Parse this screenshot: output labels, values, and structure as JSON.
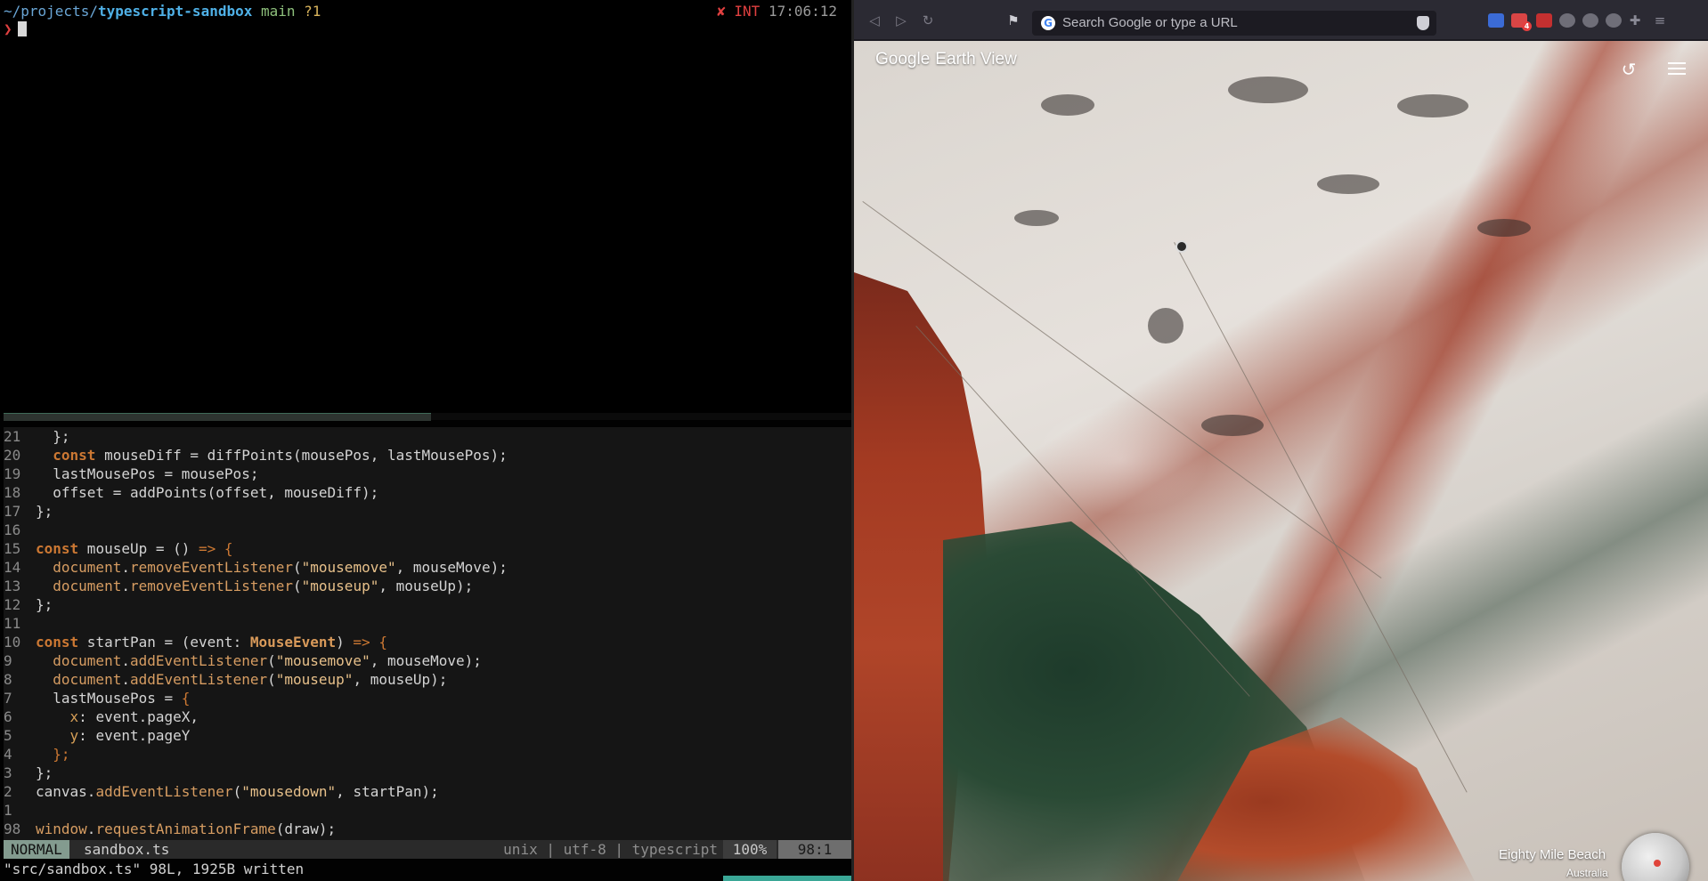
{
  "terminal": {
    "prompt": {
      "path_prefix": "~/projects/",
      "path_dir": "typescript-sandbox",
      "branch": "main",
      "git_status": "?1",
      "error_mark": "✘",
      "signal": "INT",
      "time": "17:06:12",
      "prompt_char": "❯"
    }
  },
  "vim": {
    "lines": [
      {
        "n": "21",
        "segments": [
          {
            "t": "  };",
            "c": "pun"
          }
        ]
      },
      {
        "n": "20",
        "segments": [
          {
            "t": "  ",
            "c": "pun"
          },
          {
            "t": "const",
            "c": "kw"
          },
          {
            "t": " mouseDiff = diffPoints(mousePos, lastMousePos);",
            "c": "pun"
          }
        ]
      },
      {
        "n": "19",
        "segments": [
          {
            "t": "  lastMousePos = mousePos;",
            "c": "pun"
          }
        ]
      },
      {
        "n": "18",
        "segments": [
          {
            "t": "  offset = addPoints(offset, mouseDiff);",
            "c": "pun"
          }
        ]
      },
      {
        "n": "17",
        "segments": [
          {
            "t": "};",
            "c": "pun"
          }
        ]
      },
      {
        "n": "16",
        "segments": []
      },
      {
        "n": "15",
        "segments": [
          {
            "t": "const",
            "c": "kw"
          },
          {
            "t": " mouseUp = () ",
            "c": "pun"
          },
          {
            "t": "=> {",
            "c": "arrow"
          }
        ]
      },
      {
        "n": "14",
        "segments": [
          {
            "t": "  ",
            "c": "pun"
          },
          {
            "t": "document",
            "c": "fn"
          },
          {
            "t": ".",
            "c": "pun"
          },
          {
            "t": "removeEventListener",
            "c": "fn"
          },
          {
            "t": "(",
            "c": "pun"
          },
          {
            "t": "\"mousemove\"",
            "c": "str"
          },
          {
            "t": ", mouseMove);",
            "c": "pun"
          }
        ]
      },
      {
        "n": "13",
        "segments": [
          {
            "t": "  ",
            "c": "pun"
          },
          {
            "t": "document",
            "c": "fn"
          },
          {
            "t": ".",
            "c": "pun"
          },
          {
            "t": "removeEventListener",
            "c": "fn"
          },
          {
            "t": "(",
            "c": "pun"
          },
          {
            "t": "\"mouseup\"",
            "c": "str"
          },
          {
            "t": ", mouseUp);",
            "c": "pun"
          }
        ]
      },
      {
        "n": "12",
        "segments": [
          {
            "t": "};",
            "c": "pun"
          }
        ]
      },
      {
        "n": "11",
        "segments": []
      },
      {
        "n": "10",
        "segments": [
          {
            "t": "const",
            "c": "kw"
          },
          {
            "t": " startPan = (event: ",
            "c": "pun"
          },
          {
            "t": "MouseEvent",
            "c": "type"
          },
          {
            "t": ") ",
            "c": "pun"
          },
          {
            "t": "=> {",
            "c": "arrow"
          }
        ]
      },
      {
        "n": "9",
        "segments": [
          {
            "t": "  ",
            "c": "pun"
          },
          {
            "t": "document",
            "c": "fn"
          },
          {
            "t": ".",
            "c": "pun"
          },
          {
            "t": "addEventListener",
            "c": "fn"
          },
          {
            "t": "(",
            "c": "pun"
          },
          {
            "t": "\"mousemove\"",
            "c": "str"
          },
          {
            "t": ", mouseMove);",
            "c": "pun"
          }
        ]
      },
      {
        "n": "8",
        "segments": [
          {
            "t": "  ",
            "c": "pun"
          },
          {
            "t": "document",
            "c": "fn"
          },
          {
            "t": ".",
            "c": "pun"
          },
          {
            "t": "addEventListener",
            "c": "fn"
          },
          {
            "t": "(",
            "c": "pun"
          },
          {
            "t": "\"mouseup\"",
            "c": "str"
          },
          {
            "t": ", mouseUp);",
            "c": "pun"
          }
        ]
      },
      {
        "n": "7",
        "segments": [
          {
            "t": "  lastMousePos = ",
            "c": "pun"
          },
          {
            "t": "{",
            "c": "arrow"
          }
        ]
      },
      {
        "n": "6",
        "segments": [
          {
            "t": "    ",
            "c": "pun"
          },
          {
            "t": "x",
            "c": "prop"
          },
          {
            "t": ": event.pageX,",
            "c": "pun"
          }
        ]
      },
      {
        "n": "5",
        "segments": [
          {
            "t": "    ",
            "c": "pun"
          },
          {
            "t": "y",
            "c": "prop"
          },
          {
            "t": ": event.pageY",
            "c": "pun"
          }
        ]
      },
      {
        "n": "4",
        "segments": [
          {
            "t": "  ",
            "c": "pun"
          },
          {
            "t": "};",
            "c": "arrow"
          }
        ]
      },
      {
        "n": "3",
        "segments": [
          {
            "t": "};",
            "c": "pun"
          }
        ]
      },
      {
        "n": "2",
        "segments": [
          {
            "t": "canvas",
            "c": "pun"
          },
          {
            "t": ".",
            "c": "pun"
          },
          {
            "t": "addEventListener",
            "c": "fn"
          },
          {
            "t": "(",
            "c": "pun"
          },
          {
            "t": "\"mousedown\"",
            "c": "str"
          },
          {
            "t": ", startPan);",
            "c": "pun"
          }
        ]
      },
      {
        "n": "1",
        "segments": []
      },
      {
        "n": "98",
        "segments": [
          {
            "t": "window",
            "c": "fn"
          },
          {
            "t": ".",
            "c": "pun"
          },
          {
            "t": "requestAnimationFrame",
            "c": "fn"
          },
          {
            "t": "(draw);",
            "c": "pun"
          }
        ]
      }
    ],
    "status": {
      "mode": "NORMAL",
      "filename": "sandbox.ts",
      "fileinfo": "unix | utf-8 | typescript",
      "percent": "100%",
      "position": "98:1"
    },
    "cmdline": "\"src/sandbox.ts\" 98L, 1925B written"
  },
  "browser": {
    "url_placeholder": "Search Google or type a URL",
    "icons": {
      "back": "back-arrow-icon",
      "forward": "forward-arrow-icon",
      "reload": "reload-icon",
      "bookmark": "bookmark-icon",
      "shield": "brave-shield-icon"
    },
    "mail_badge": "4",
    "extension_colors": [
      "#3b6bd6",
      "#d94545",
      "#c43030",
      "#8a8a96",
      "#8a8a96",
      "#8a8a96",
      "#8a8a96"
    ]
  },
  "earth_view": {
    "brand": "Google",
    "title": "Earth View",
    "place": "Eighty Mile Beach",
    "country": "Australia"
  }
}
